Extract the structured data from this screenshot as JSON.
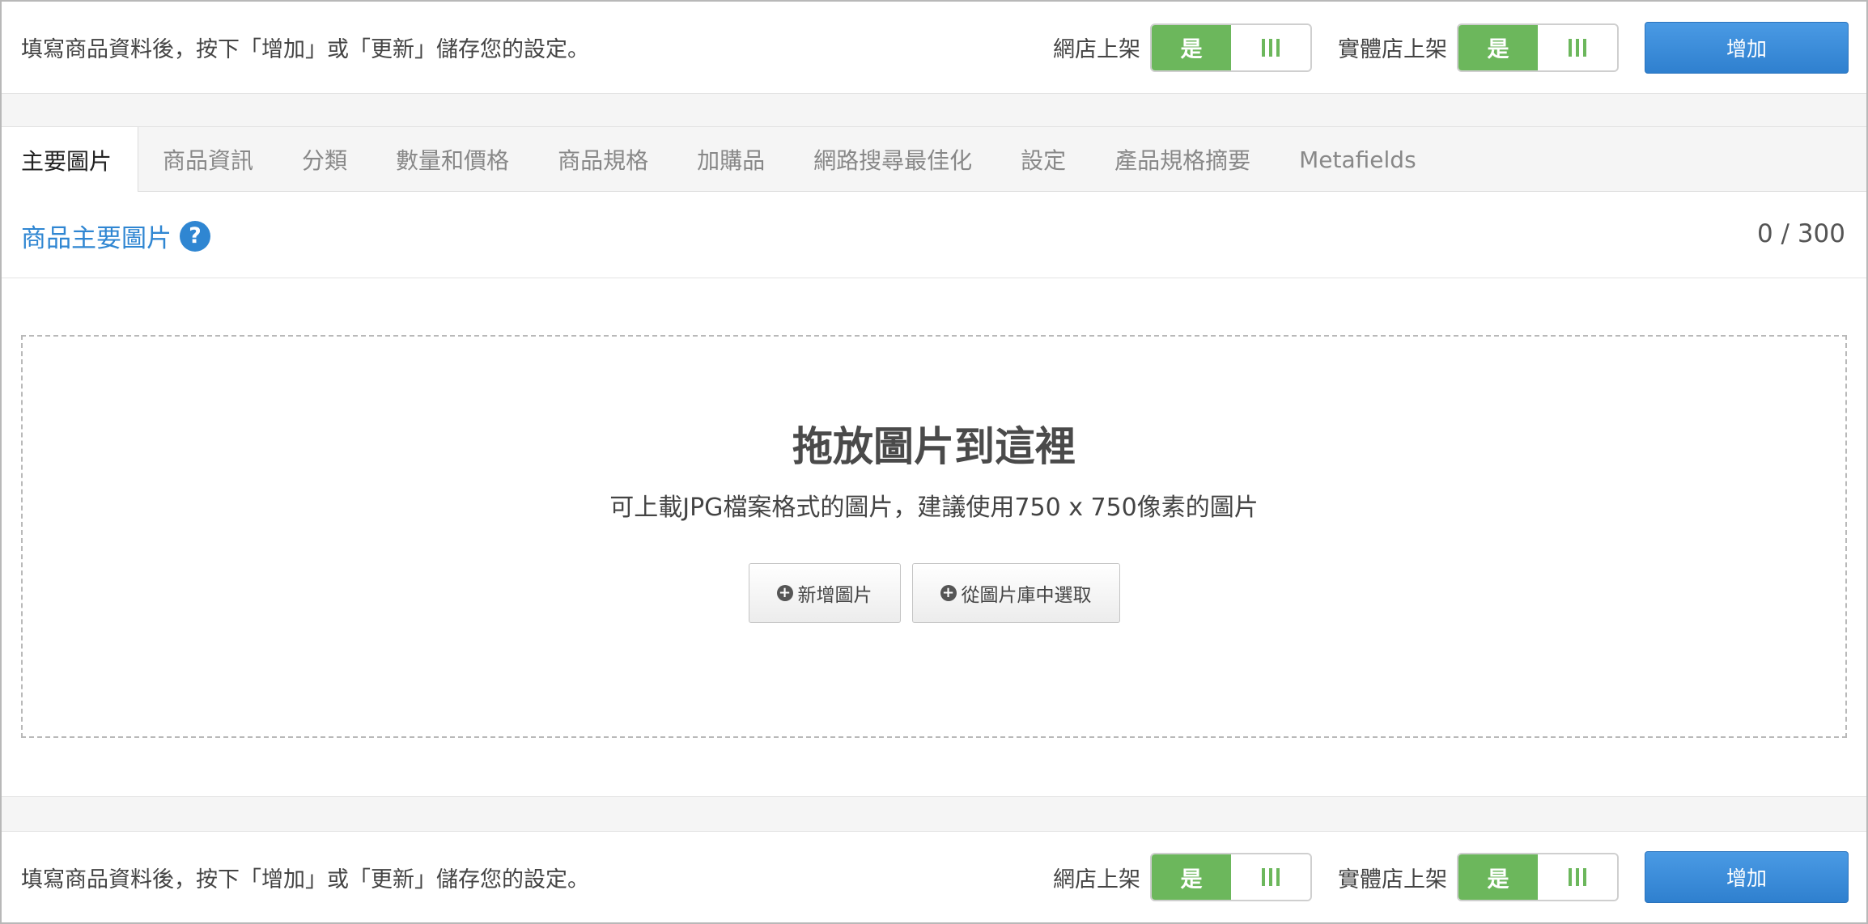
{
  "action_bar": {
    "hint": "填寫商品資料後，按下「增加」或「更新」儲存您的設定。",
    "online_store_label": "網店上架",
    "retail_store_label": "實體店上架",
    "toggle_on_label": "是",
    "add_button_label": "增加"
  },
  "tabs": [
    {
      "label": "主要圖片",
      "active": true
    },
    {
      "label": "商品資訊",
      "active": false
    },
    {
      "label": "分類",
      "active": false
    },
    {
      "label": "數量和價格",
      "active": false
    },
    {
      "label": "商品規格",
      "active": false
    },
    {
      "label": "加購品",
      "active": false
    },
    {
      "label": "網路搜尋最佳化",
      "active": false
    },
    {
      "label": "設定",
      "active": false
    },
    {
      "label": "產品規格摘要",
      "active": false
    },
    {
      "label": "Metafields",
      "active": false
    }
  ],
  "panel": {
    "title": "商品主要圖片",
    "help_icon": "question-circle-icon",
    "counter": "0 / 300"
  },
  "dropzone": {
    "title": "拖放圖片到這裡",
    "subtitle": "可上載JPG檔案格式的圖片，建議使用750 x 750像素的圖片",
    "add_image_label": "新增圖片",
    "choose_gallery_label": "從圖片庫中選取"
  },
  "colors": {
    "accent_blue": "#2f86d2",
    "toggle_green": "#6cb75c",
    "add_button": "#3a8ad8"
  }
}
